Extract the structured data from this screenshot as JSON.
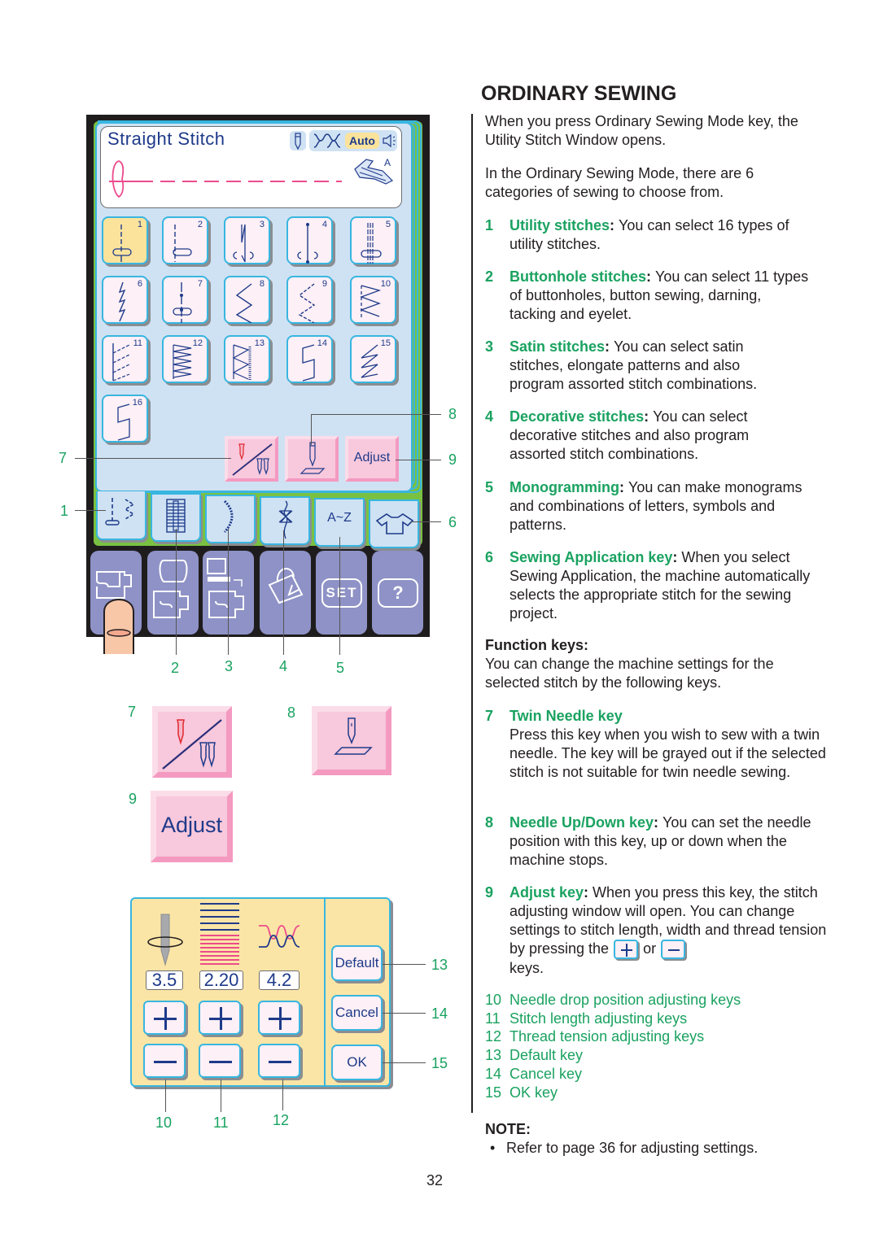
{
  "page": {
    "heading": "ORDINARY SEWING",
    "page_number": "32"
  },
  "lcd": {
    "window_title": "Straight Stitch",
    "auto_label": "Auto",
    "presser_foot": "A",
    "stitches": [
      {
        "num": "1",
        "icon": "straight-stitch-center-icon",
        "selected": true
      },
      {
        "num": "2",
        "icon": "straight-stitch-left-icon"
      },
      {
        "num": "3",
        "icon": "lock-stitch-icon"
      },
      {
        "num": "4",
        "icon": "locking-stop-stitch-icon"
      },
      {
        "num": "5",
        "icon": "triple-straight-stitch-icon"
      },
      {
        "num": "6",
        "icon": "stretch-stitch-icon"
      },
      {
        "num": "7",
        "icon": "basting-stitch-icon"
      },
      {
        "num": "8",
        "icon": "zigzag-stitch-icon"
      },
      {
        "num": "9",
        "icon": "multi-zigzag-stitch-icon"
      },
      {
        "num": "10",
        "icon": "overcast-stitch-icon"
      },
      {
        "num": "11",
        "icon": "blind-hem-stitch-icon"
      },
      {
        "num": "12",
        "icon": "triple-zigzag-stitch-icon"
      },
      {
        "num": "13",
        "icon": "overlock-stitch-icon"
      },
      {
        "num": "14",
        "icon": "blanket-stitch-icon"
      },
      {
        "num": "15",
        "icon": "knit-stitch-icon"
      },
      {
        "num": "16",
        "icon": "stretch-blind-hem-icon"
      }
    ],
    "function_keys": {
      "twin_needle": "twin-needle-icon",
      "needle_up_down": "needle-up-down-icon",
      "adjust_label": "Adjust"
    },
    "category_tabs": [
      {
        "name": "utility-stitches",
        "icon": "utility-stitch-icon"
      },
      {
        "name": "buttonhole-stitches",
        "icon": "buttonhole-icon"
      },
      {
        "name": "satin-stitches",
        "icon": "satin-stitch-icon"
      },
      {
        "name": "decorative-stitches",
        "icon": "decorative-stitch-icon"
      },
      {
        "name": "monogramming",
        "label": "A~Z"
      },
      {
        "name": "sewing-application",
        "icon": "shirt-icon"
      }
    ],
    "mode_keys": [
      {
        "name": "ordinary-sewing-mode",
        "icon": "sewing-machine-icon"
      },
      {
        "name": "embroidery-mode",
        "icon": "embroidery-machine-icon"
      },
      {
        "name": "pc-link-mode",
        "icon": "computer-link-icon"
      },
      {
        "name": "bag-mode",
        "icon": "bag-icon"
      },
      {
        "name": "set-mode",
        "label": "SET"
      },
      {
        "name": "help-mode",
        "label": "?"
      }
    ]
  },
  "callouts": {
    "left": [
      "7",
      "1"
    ],
    "right": [
      "8",
      "9",
      "6"
    ],
    "bottom": [
      "2",
      "3",
      "4",
      "5"
    ],
    "detail_twin": "7",
    "detail_needle": "8",
    "detail_adjust": "9",
    "adjust_window": [
      "10",
      "11",
      "12",
      "13",
      "14",
      "15"
    ]
  },
  "detail_keys": {
    "adjust_label": "Adjust"
  },
  "adjust_window": {
    "needle_drop": "3.5",
    "stitch_length": "2.20",
    "thread_tension": "4.2",
    "default_label": "Default",
    "cancel_label": "Cancel",
    "ok_label": "OK"
  },
  "text": {
    "intro1": "When you press Ordinary Sewing Mode key, the Utility Stitch Window opens.",
    "intro2": "In the Ordinary Sewing Mode, there are 6 categories of sewing to choose from.",
    "items": [
      {
        "num": "1",
        "label": "Utility stitches",
        "desc": "You can select 16 types of utility stitches."
      },
      {
        "num": "2",
        "label": "Buttonhole stitches",
        "desc": "You can select 11 types of buttonholes, button sewing, darning, tacking and eyelet."
      },
      {
        "num": "3",
        "label": "Satin stitches",
        "desc": "You can select satin stitches, elongate patterns and also program assorted stitch combinations."
      },
      {
        "num": "4",
        "label": "Decorative stitches",
        "desc": "You can select decorative stitches and also program assorted stitch combinations."
      },
      {
        "num": "5",
        "label": "Monogramming",
        "desc": "You can make monograms and combinations of letters, symbols and patterns."
      },
      {
        "num": "6",
        "label": "Sewing Application key",
        "desc": "When you select Sewing Application, the machine automatically selects the appropriate stitch for the sewing project."
      }
    ],
    "function_keys_heading": "Function keys:",
    "function_keys_desc": "You can change the machine settings for the selected stitch by the following keys.",
    "key7": {
      "num": "7",
      "label": "Twin Needle key",
      "desc": "Press this key when you wish to sew with a twin needle. The key will be grayed out if the selected stitch is not suitable for twin needle sewing."
    },
    "key8": {
      "num": "8",
      "label": "Needle Up/Down key",
      "desc": "You can set the needle position with this key, up or down when the machine stops."
    },
    "key9": {
      "num": "9",
      "label": "Adjust key",
      "desc_a": "When you press this key, the stitch adjusting window will open. You can change settings to stitch length, width and thread tension by pressing the",
      "desc_or": "or",
      "desc_b": "keys."
    },
    "list": [
      {
        "num": "10",
        "label": "Needle drop position adjusting keys"
      },
      {
        "num": "11",
        "label": "Stitch length adjusting keys"
      },
      {
        "num": "12",
        "label": "Thread tension adjusting keys"
      },
      {
        "num": "13",
        "label": "Default key"
      },
      {
        "num": "14",
        "label": "Cancel key"
      },
      {
        "num": "15",
        "label": "OK key"
      }
    ],
    "note_heading": "NOTE:",
    "note_bullet": "Refer to page 36 for adjusting settings."
  },
  "colors": {
    "callout_green": "#1aa260",
    "lcd_blue": "#cfe2f3",
    "frame_cyan": "#38b6e0",
    "key_pink": "#f8c8dc",
    "mode_key_purple": "#8e92c6",
    "adjust_bg": "#fbe5a6",
    "icon_navy": "#1e3a8a"
  }
}
